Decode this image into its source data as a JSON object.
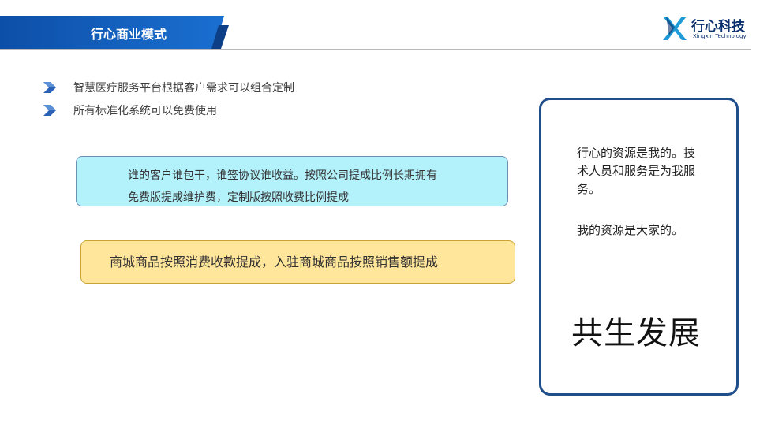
{
  "header": {
    "title": "行心商业模式",
    "colors": {
      "bar": "#1565c0",
      "bar_dark": "#0d3f86"
    }
  },
  "logo": {
    "name_cn": "行心科技",
    "name_en": "Xingxin Technology"
  },
  "bullets": [
    {
      "icon": "chevron-right-icon",
      "text": "智慧医疗服务平台根据客户需求可以组合定制"
    },
    {
      "icon": "chevron-right-icon",
      "text": "所有标准化系统可以免费使用"
    }
  ],
  "cyan_box": {
    "line1": "谁的客户谁包干，谁签协议谁收益。按照公司提成比例长期拥有",
    "line2": "免费版提成维护费，定制版按照收费比例提成"
  },
  "yellow_box": {
    "text": "商城商品按照消费收款提成，入驻商城商品按照销售额提成"
  },
  "panel": {
    "para1": "行心的资源是我的。技术人员和服务是为我服务。",
    "para2": "我的资源是大家的。",
    "slogan": "共生发展"
  }
}
